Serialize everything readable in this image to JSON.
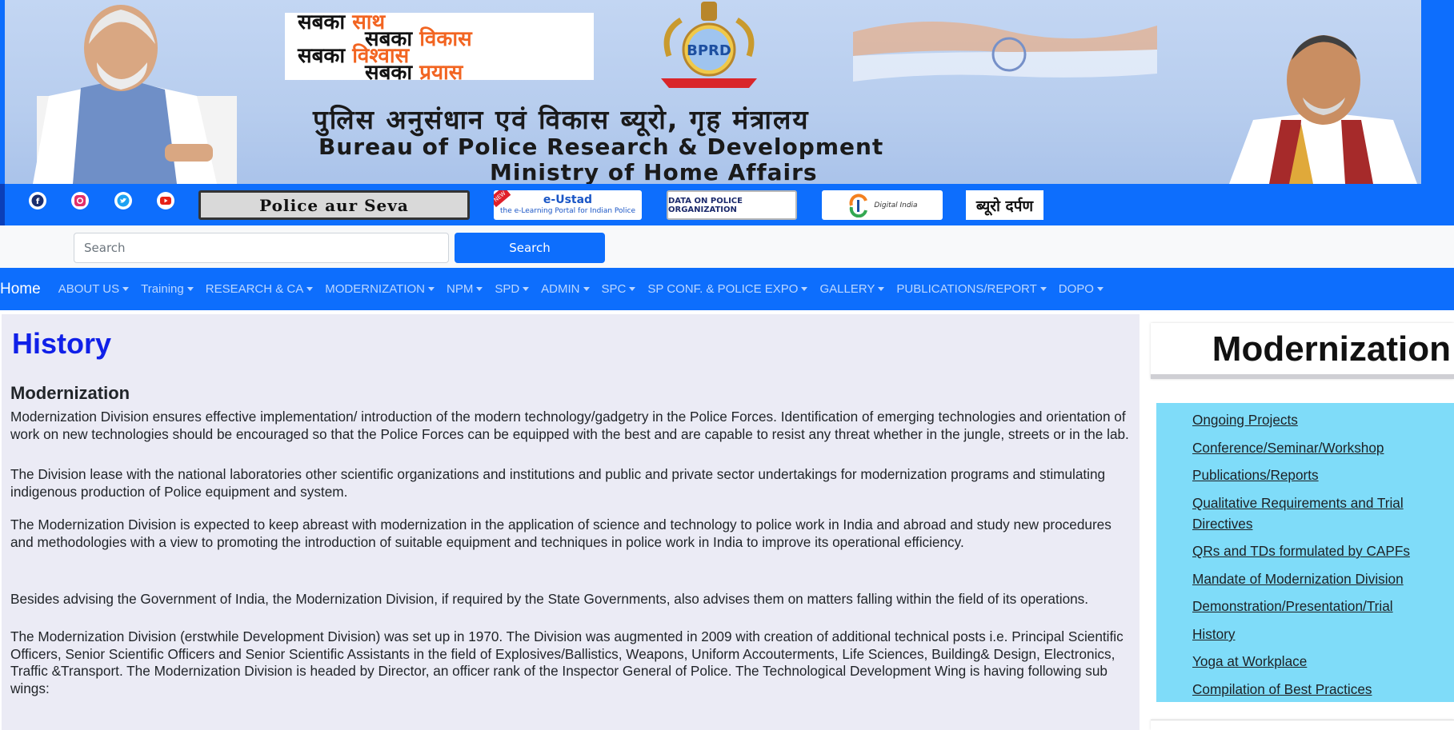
{
  "banner": {
    "slogan": [
      "सबका",
      "साथ",
      "सबका",
      "विकास",
      "सबका",
      "विश्वास",
      "सबका",
      "प्रयास"
    ],
    "logo_text": "BPRD",
    "title_hindi": "पुलिस अनुसंधान एवं विकास ब्यूरो, गृह मंत्रालय",
    "title_english": "Bureau of Police Research & Development",
    "subtitle_english": "Ministry of Home Affairs"
  },
  "strip": {
    "social_icons": [
      "facebook-icon",
      "instagram-icon",
      "twitter-icon",
      "youtube-icon"
    ],
    "police_aur_seva": "Police aur Seva",
    "eustad_title": "e-Ustad",
    "eustad_sub": "the e-Learning Portal for Indian Police",
    "eustad_badge": "NEW",
    "dopo": "DATA ON POLICE ORGANIZATION",
    "digital_india": "Digital India",
    "bureau_darpan": "ब्यूरो दर्पण"
  },
  "search": {
    "placeholder": "Search",
    "button_label": "Search"
  },
  "nav": {
    "home": "Home",
    "items": [
      "ABOUT US",
      "Training",
      "RESEARCH & CA",
      "MODERNIZATION",
      "NPM",
      "SPD",
      "ADMIN",
      "SPC",
      "SP CONF. & POLICE EXPO",
      "GALLERY",
      "PUBLICATIONS/REPORT",
      "DOPO"
    ]
  },
  "content": {
    "page_title": "History",
    "section_title": "Modernization",
    "paragraphs": [
      "Modernization Division ensures effective implementation/ introduction of the modern technology/gadgetry in the Police Forces. Identification of emerging technologies and orientation of work on new technologies should be encouraged so that the Police Forces can be equipped with the best and are capable to resist any threat whether in the jungle, streets or in the lab.",
      "The Division lease with the national laboratories other scientific organizations and institutions and public and private sector undertakings for modernization programs and stimulating indigenous production of Police equipment and system.",
      "The Modernization Division is expected to keep abreast with modernization in the application of science and technology to police work in India and abroad and study new procedures and methodologies with a view to promoting the introduction of suitable equipment and techniques in police work in India to improve its operational efficiency.",
      "Besides advising the Government of India, the Modernization Division, if required by the State Governments, also advises them on matters falling within the field of its operations.",
      "The Modernization Division (erstwhile Development Division) was set up in 1970. The Division was augmented in 2009 with creation of additional technical posts i.e. Principal Scientific Officers, Senior Scientific Officers and Senior Scientific Assistants in the field of Explosives/Ballistics, Weapons, Uniform Accouterments, Life Sciences, Building& Design, Electronics, Traffic &Transport. The Modernization Division is headed by Director, an officer rank of the Inspector General of Police. The Technological Development Wing is having following sub wings:"
    ]
  },
  "sidebar": {
    "heading": "Modernization",
    "links": [
      "Ongoing Projects",
      "Conference/Seminar/Workshop",
      "Publications/Reports",
      "Qualitative Requirements and Trial Directives",
      "QRs and TDs formulated by CAPFs",
      "Mandate of Modernization Division",
      "Demonstration/Presentation/Trial",
      "History",
      "Yoga at Workplace",
      "Compilation of Best Practices"
    ]
  },
  "colors": {
    "primary": "#0d6efd",
    "title_blue": "#1020e8",
    "sidebar_bg": "#7fdcf9",
    "content_bg": "#ebebf5"
  }
}
